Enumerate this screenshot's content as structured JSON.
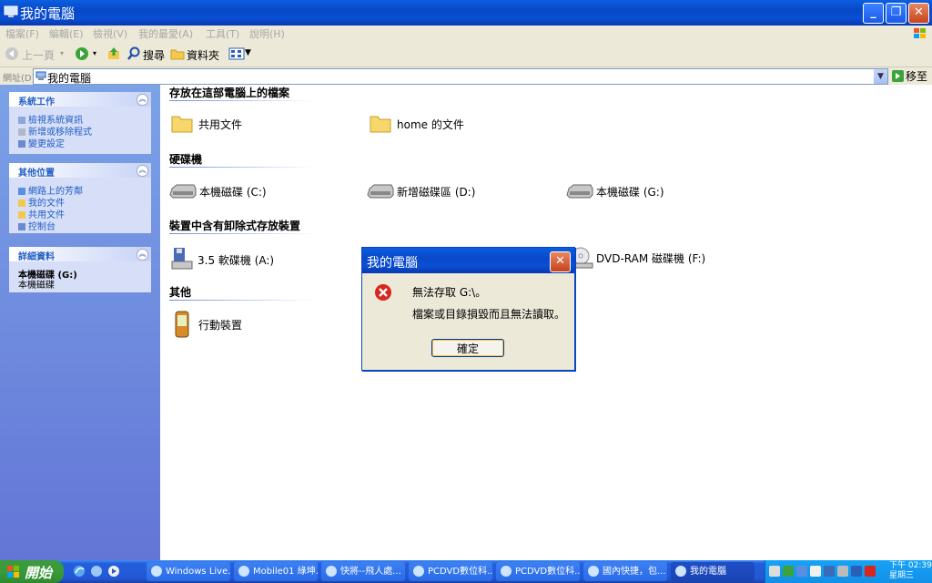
{
  "window": {
    "title": "我的電腦"
  },
  "menu": [
    "檔案(F)",
    "編輯(E)",
    "檢視(V)",
    "我的最愛(A)",
    "工具(T)",
    "說明(H)"
  ],
  "toolbar": {
    "back": "上一頁",
    "search": "搜尋",
    "folders": "資料夾"
  },
  "address": {
    "label": "網址(D)",
    "value": "我的電腦",
    "go": "移至"
  },
  "left": {
    "system": {
      "title": "系統工作",
      "items": [
        "檢視系統資訊",
        "新增或移除程式",
        "變更設定"
      ]
    },
    "other": {
      "title": "其他位置",
      "items": [
        "網路上的芳鄰",
        "我的文件",
        "共用文件",
        "控制台"
      ]
    },
    "details": {
      "title": "詳細資料",
      "name": "本機磁碟 (G:)",
      "type": "本機磁碟"
    }
  },
  "main": {
    "sec_files": "存放在這部電腦上的檔案",
    "shared_docs": "共用文件",
    "home_docs": "home 的文件",
    "sec_drives": "硬碟機",
    "drive_c": "本機磁碟 (C:)",
    "drive_d": "新增磁碟區 (D:)",
    "drive_g": "本機磁碟 (G:)",
    "sec_removable": "裝置中含有卸除式存放裝置",
    "floppy": "3.5 軟碟機 (A:)",
    "dvd": "DVD-RAM 磁碟機 (F:)",
    "sec_other": "其他",
    "mobile": "行動裝置"
  },
  "dialog": {
    "title": "我的電腦",
    "msg1": "無法存取 G:\\。",
    "msg2": "檔案或目錄損毀而且無法讀取。",
    "ok": "確定"
  },
  "taskbar": {
    "start": "開始",
    "tasks": [
      "Windows Live...",
      "Mobile01 綠坤...",
      "快將--飛人處...",
      "PCDVD數位科...",
      "PCDVD數位科...",
      "國內快捷，包...",
      "我的電腦"
    ],
    "clock_time": "下午 02:39",
    "clock_day": "星期三"
  },
  "colors": {
    "title_blue": "#0848c8",
    "accent_link": "#215dc6",
    "start_green": "#3a9a3a",
    "error_red": "#d8261d"
  }
}
